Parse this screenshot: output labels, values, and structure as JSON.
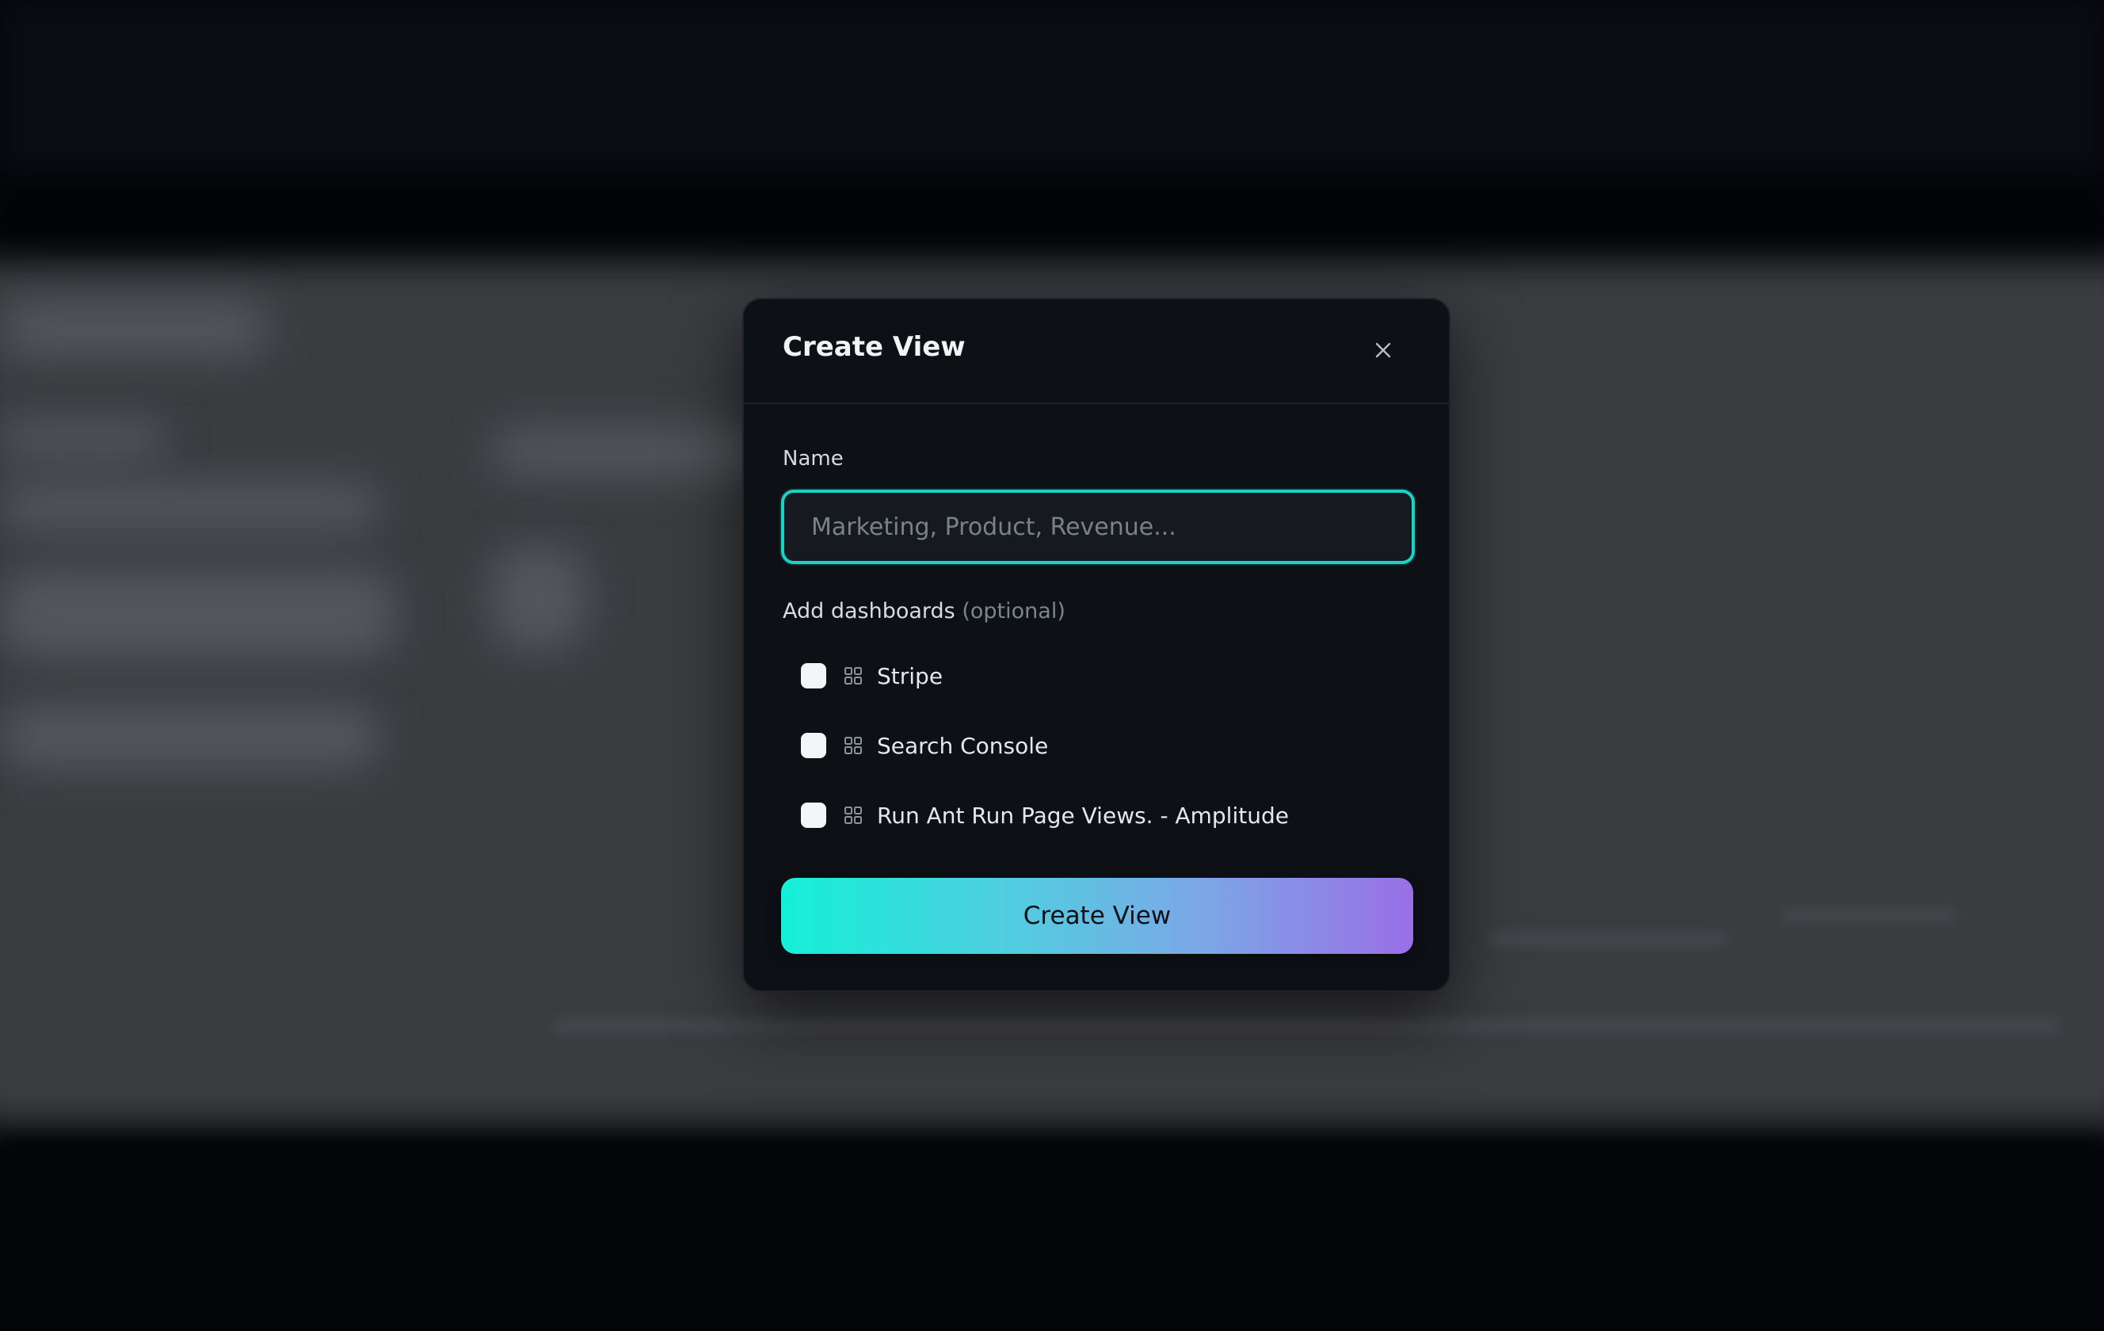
{
  "modal": {
    "title": "Create View",
    "close_icon": "close-icon",
    "name_label": "Name",
    "name_input": {
      "value": "",
      "placeholder": "Marketing, Product, Revenue..."
    },
    "dashboards_label": "Add dashboards",
    "dashboards_optional": "(optional)",
    "dashboards": [
      {
        "label": "Stripe",
        "checked": false,
        "icon": "grid-icon"
      },
      {
        "label": "Search Console",
        "checked": false,
        "icon": "grid-icon"
      },
      {
        "label": "Run Ant Run Page Views. - Amplitude",
        "checked": false,
        "icon": "grid-icon"
      }
    ],
    "submit_label": "Create View"
  },
  "colors": {
    "accent_teal": "#19d3c5",
    "gradient_start": "#14f0d8",
    "gradient_end": "#9a6fe6",
    "modal_bg": "#0d1015"
  }
}
